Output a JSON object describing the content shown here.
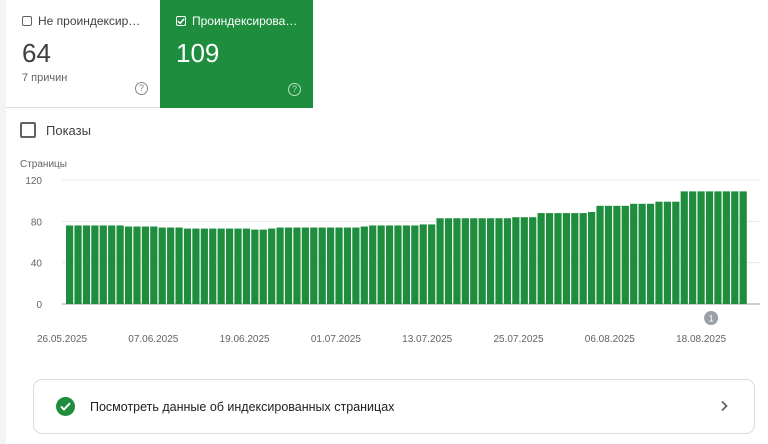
{
  "summary": {
    "not_indexed": {
      "label": "Не проиндексир…",
      "value": "64",
      "subtitle": "7 причин"
    },
    "indexed": {
      "label": "Проиндексирова…",
      "value": "109"
    }
  },
  "impressions_label": "Показы",
  "view_link": {
    "label": "Посмотреть данные об индексированных страницах"
  },
  "colors": {
    "accent_green": "#1e8e3e",
    "grid": "#e8eaed"
  },
  "chart_data": {
    "type": "bar",
    "ylabel": "Страницы",
    "ylim": [
      0,
      120
    ],
    "yticks": [
      0,
      40,
      80,
      120
    ],
    "x_tick_labels": [
      "26.05.2025",
      "07.06.2025",
      "19.06.2025",
      "01.07.2025",
      "13.07.2025",
      "25.07.2025",
      "06.08.2025",
      "18.08.2025"
    ],
    "annotation": {
      "label": "1",
      "date": "18.08.2025"
    },
    "series": [
      {
        "values": [
          76,
          76,
          76,
          76,
          76,
          76,
          76,
          75,
          75,
          75,
          75,
          74,
          74,
          74,
          73,
          73,
          73,
          73,
          73,
          73,
          73,
          73,
          72,
          72,
          73,
          74,
          74,
          74,
          74,
          74,
          74,
          74,
          74,
          74,
          74,
          75,
          76,
          76,
          76,
          76,
          76,
          76,
          77,
          77,
          83,
          83,
          83,
          83,
          83,
          83,
          83,
          83,
          83,
          84,
          84,
          84,
          88,
          88,
          88,
          88,
          88,
          88,
          89,
          95,
          95,
          95,
          95,
          97,
          97,
          97,
          99,
          99,
          99,
          109,
          109,
          109,
          109,
          109,
          109,
          109,
          109
        ]
      }
    ]
  }
}
